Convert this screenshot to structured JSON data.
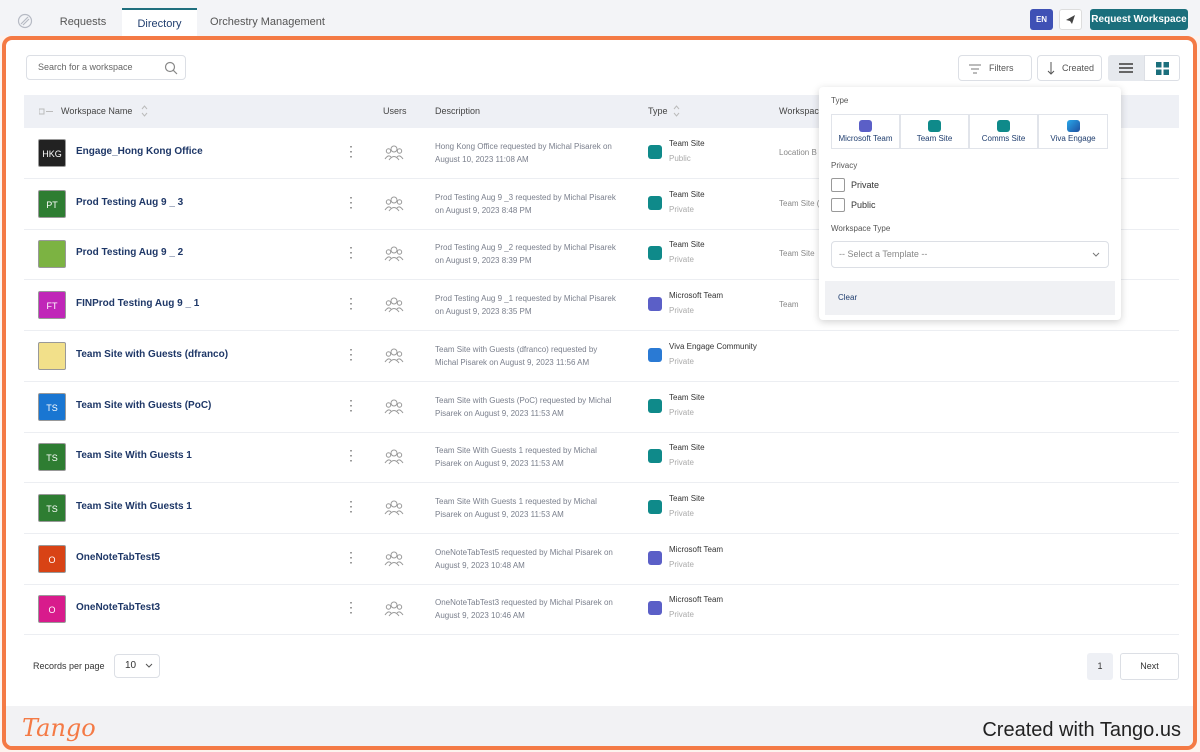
{
  "topbar": {
    "tabs": [
      {
        "label": "Requests",
        "active": false
      },
      {
        "label": "Directory",
        "active": true
      },
      {
        "label": "Orchestry Management",
        "active": false
      }
    ],
    "language": "EN",
    "request_button": "Request Workspace"
  },
  "toolbar": {
    "search_placeholder": "Search for a workspace",
    "filters_label": "Filters",
    "sort_label": "Created"
  },
  "table": {
    "headers": {
      "name": "Workspace Name",
      "users": "Users",
      "description": "Description",
      "type": "Type",
      "workspace_type": "Workspac"
    },
    "rows": [
      {
        "name": "Engage_Hong Kong Office",
        "avatar_text": "HKG",
        "avatar_color": "#222222",
        "desc1": "Hong Kong Office requested by Michal Pisarek on",
        "desc2": "August 10, 2023 11:08 AM",
        "type": "Team Site",
        "privacy": "Public",
        "ws_type": "Location B",
        "type_kind": "sp"
      },
      {
        "name": "Prod Testing Aug 9 _ 3",
        "avatar_text": "PT",
        "avatar_color": "#2e7d32",
        "desc1": "Prod Testing Aug 9 _3 requested by Michal Pisarek",
        "desc2": "on August 9, 2023 8:48 PM",
        "type": "Team Site",
        "privacy": "Private",
        "ws_type": "Team Site (",
        "type_kind": "sp"
      },
      {
        "name": "Prod Testing Aug 9 _ 2",
        "avatar_text": "",
        "avatar_color": "#7cb342",
        "desc1": "Prod Testing Aug 9 _2 requested by Michal Pisarek",
        "desc2": "on August 9, 2023 8:39 PM",
        "type": "Team Site",
        "privacy": "Private",
        "ws_type": "Team Site",
        "type_kind": "sp"
      },
      {
        "name": "FINProd Testing Aug 9 _ 1",
        "avatar_text": "FT",
        "avatar_color": "#c026b8",
        "desc1": "Prod Testing Aug 9 _1 requested by Michal Pisarek",
        "desc2": "on August 9, 2023 8:35 PM",
        "type": "Microsoft Team",
        "privacy": "Private",
        "ws_type": "Team",
        "type_kind": "teams"
      },
      {
        "name": "Team Site with Guests (dfranco)",
        "avatar_text": "",
        "avatar_color": "#f2e08a",
        "desc1": "Team Site with Guests (dfranco) requested by",
        "desc2": "Michal Pisarek on August 9, 2023 11:56 AM",
        "type": "Viva Engage Community",
        "privacy": "Private",
        "ws_type": "",
        "type_kind": "viva"
      },
      {
        "name": "Team Site with Guests (PoC)",
        "avatar_text": "TS",
        "avatar_color": "#1976d2",
        "desc1": "Team Site with Guests (PoC) requested by Michal",
        "desc2": "Pisarek on August 9, 2023 11:53 AM",
        "type": "Team Site",
        "privacy": "Private",
        "ws_type": "",
        "type_kind": "sp"
      },
      {
        "name": "Team Site With Guests 1",
        "avatar_text": "TS",
        "avatar_color": "#2e7d32",
        "desc1": "Team Site With Guests 1 requested by Michal",
        "desc2": "Pisarek on August 9, 2023 11:53 AM",
        "type": "Team Site",
        "privacy": "Private",
        "ws_type": "",
        "type_kind": "sp"
      },
      {
        "name": "Team Site With Guests 1",
        "avatar_text": "TS",
        "avatar_color": "#2e7d32",
        "desc1": "Team Site With Guests 1 requested by Michal",
        "desc2": "Pisarek on August 9, 2023 11:53 AM",
        "type": "Team Site",
        "privacy": "Private",
        "ws_type": "",
        "type_kind": "sp"
      },
      {
        "name": "OneNoteTabTest5",
        "avatar_text": "O",
        "avatar_color": "#d84315",
        "desc1": "OneNoteTabTest5 requested by Michal Pisarek on",
        "desc2": "August 9, 2023 10:48 AM",
        "type": "Microsoft Team",
        "privacy": "Private",
        "ws_type": "",
        "type_kind": "teams"
      },
      {
        "name": "OneNoteTabTest3",
        "avatar_text": "O",
        "avatar_color": "#d81b8c",
        "desc1": "OneNoteTabTest3 requested by Michal Pisarek on",
        "desc2": "August 9, 2023 10:46 AM",
        "type": "Microsoft Team",
        "privacy": "Private",
        "ws_type": "",
        "type_kind": "teams"
      }
    ]
  },
  "pagination": {
    "records_label": "Records per page",
    "records_value": "10",
    "current_page": "1",
    "next_label": "Next"
  },
  "filter_panel": {
    "type_label": "Type",
    "types": [
      "Microsoft Team",
      "Team Site",
      "Comms Site",
      "Viva Engage"
    ],
    "privacy_label": "Privacy",
    "privacy_options": [
      "Private",
      "Public"
    ],
    "workspace_type_label": "Workspace Type",
    "template_placeholder": "-- Select a Template --",
    "clear_label": "Clear"
  },
  "footer": {
    "logo": "Tango",
    "text": "Created with Tango.us"
  },
  "colors": {
    "accent": "#1b6f7c",
    "frame": "#f47a45",
    "teams": "#5b5fc7",
    "sharepoint": "#0f8a8a"
  }
}
